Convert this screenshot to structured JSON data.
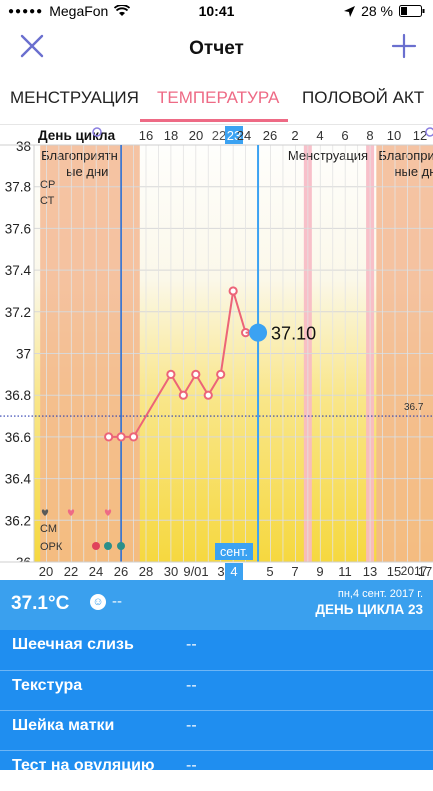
{
  "status_bar": {
    "carrier": "MegaFon",
    "time": "10:41",
    "battery": "28 %"
  },
  "nav": {
    "title": "Отчет",
    "close_icon": "close-icon",
    "add_icon": "plus-icon"
  },
  "tabs": [
    {
      "label": "МЕНСТРУАЦИЯ"
    },
    {
      "label": "ТЕМПЕРАТУРА",
      "active": true
    },
    {
      "label": "ПОЛОВОЙ АКТ"
    }
  ],
  "chart_data": {
    "type": "line",
    "title": "",
    "ylim": [
      36,
      38
    ],
    "y_ticks": [
      "38",
      "37.8",
      "37.6",
      "37.4",
      "37.2",
      "37",
      "36.8",
      "36.6",
      "36.4",
      "36.2",
      "36"
    ],
    "header_label": "День цикла",
    "cycle_day_labels": [
      "16",
      "18",
      "20",
      "22",
      "23",
      "24",
      "26",
      "2",
      "4",
      "6",
      "8",
      "10",
      "12"
    ],
    "date_labels": [
      "20",
      "22",
      "24",
      "26",
      "28",
      "30",
      "9/01",
      "3",
      "4",
      "5",
      "7",
      "9",
      "11",
      "13",
      "15",
      "17"
    ],
    "year_label": "2017",
    "month_label": "сент.",
    "x_range": [
      "2017-08-19",
      "2017-09-18"
    ],
    "series": [
      {
        "x": [
          "2017-08-23",
          "2017-08-24",
          "2017-08-25",
          "2017-08-28",
          "2017-08-29",
          "2017-08-30",
          "2017-08-31",
          "2017-09-01",
          "2017-09-02",
          "2017-09-03"
        ],
        "values": [
          36.6,
          36.6,
          36.6,
          36.9,
          36.8,
          36.9,
          36.8,
          36.9,
          37.3,
          37.1
        ]
      }
    ],
    "coverline": {
      "value": 36.7,
      "label": "36.7"
    },
    "selected": {
      "date": "2017-09-04",
      "value": 37.1,
      "label": "37.10",
      "cycle_day": "23"
    },
    "fertile_windows": [
      {
        "label": "Благоприятные дни",
        "from": "2017-08-18",
        "to": "2017-08-25"
      },
      {
        "label": "Благоприятные дни",
        "from": "2017-09-14",
        "to": "2017-09-18"
      }
    ],
    "menstruation": {
      "label": "Менструация",
      "from": "2017-09-08",
      "to": "2017-09-13"
    },
    "ovulation_marker_date": "2017-08-24",
    "left_annotations": [
      "СР",
      "СТ",
      "СМ",
      "ОРК"
    ],
    "colors": {
      "line": "#ec6478",
      "selected": "#3ba2f2",
      "fertile": "#f3b68f",
      "yellow": "#f7d94c"
    }
  },
  "summary": {
    "temperature": "37.1°C",
    "mood_icon": "smiley-icon",
    "mood_value": "--",
    "date": "пн,4 сент. 2017 г.",
    "cycle_day": "ДЕНЬ ЦИКЛА 23"
  },
  "details": [
    {
      "label": "Шеечная слизь",
      "value": "--"
    },
    {
      "label": "Текстура",
      "value": "--"
    },
    {
      "label": "Шейка матки",
      "value": "--"
    },
    {
      "label": "Тест на овуляцию",
      "value": "--"
    }
  ]
}
